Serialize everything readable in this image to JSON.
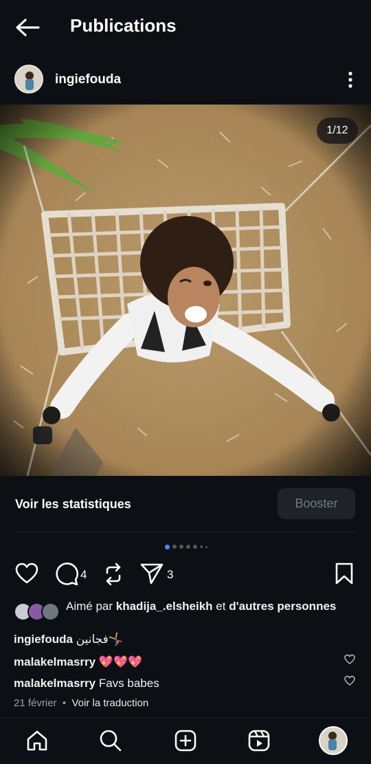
{
  "header": {
    "title": "Publications"
  },
  "post": {
    "author": {
      "username": "ingiefouda"
    },
    "media": {
      "counter": "1/12",
      "current_index": 1,
      "total": 12
    },
    "stats_link": "Voir les statistiques",
    "boost_label": "Booster",
    "actions": {
      "comments_count": "4",
      "shares_count": "3"
    },
    "likes": {
      "prefix": "Aimé par",
      "user": "khadija_.elsheikh",
      "connector": "et",
      "others": "d'autres personnes"
    },
    "caption": {
      "username": "ingiefouda",
      "text": "فجانين🤸‍♀️"
    },
    "comments": [
      {
        "username": "malakelmasrry",
        "text": "💖💖💖"
      },
      {
        "username": "malakelmasrry",
        "text": "Favs babes"
      }
    ],
    "date": "21 février",
    "separator": "•",
    "translate": "Voir la traduction"
  },
  "icons": {
    "back": "arrow-left-icon",
    "more": "more-vertical-icon",
    "like": "heart-icon",
    "comment": "comment-icon",
    "repost": "repost-icon",
    "share": "send-icon",
    "save": "bookmark-icon",
    "home": "home-icon",
    "search": "search-icon",
    "create": "plus-square-icon",
    "reels": "reels-icon"
  },
  "colors": {
    "background": "#0c0f14",
    "accent": "#4a8cf5",
    "boost_bg": "#1f2327"
  }
}
